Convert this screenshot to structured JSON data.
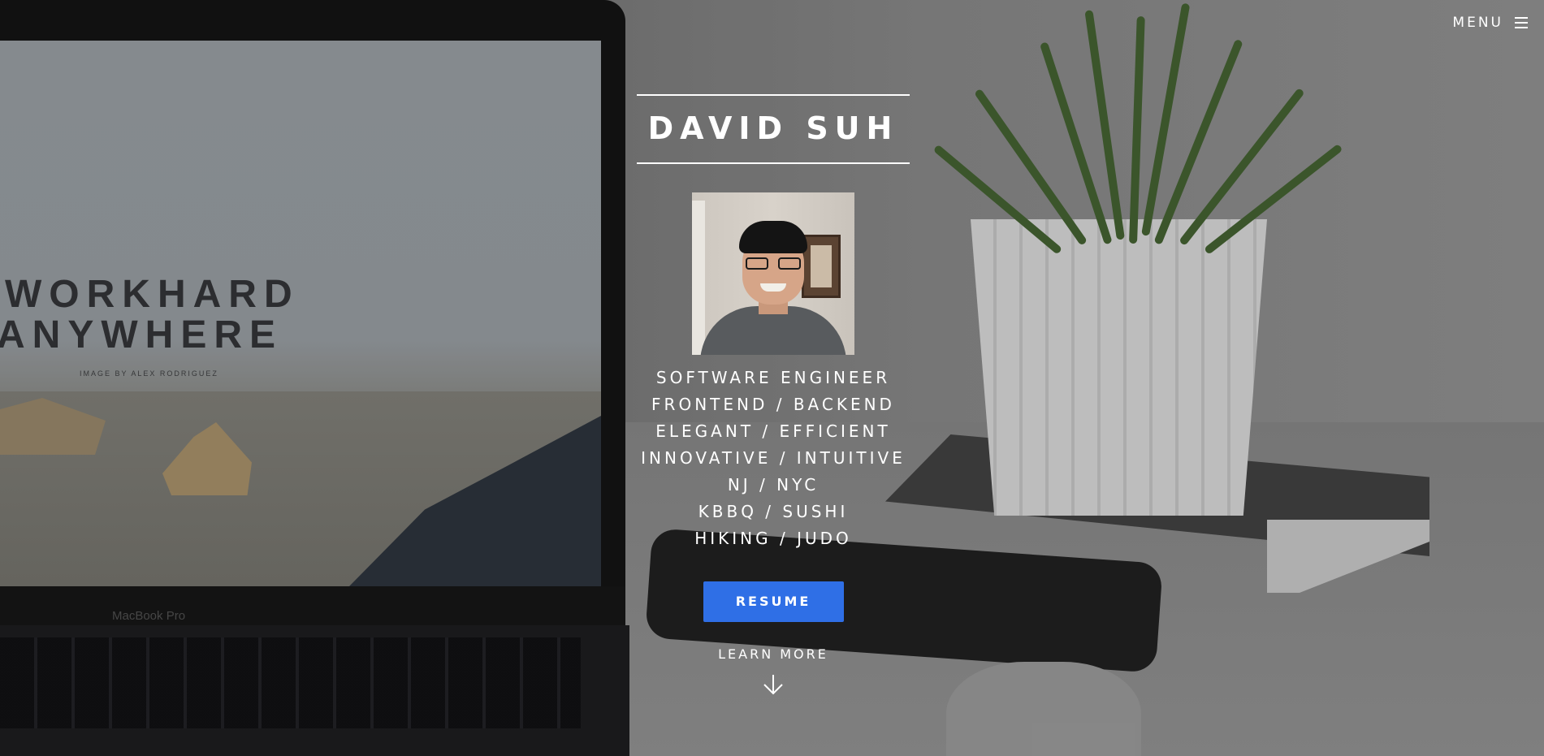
{
  "background": {
    "screen_text_line1": "WORKHARD",
    "screen_text_line2": "ANYWHERE",
    "screen_credit": "IMAGE BY ALEX RODRIGUEZ",
    "laptop_model": "MacBook Pro"
  },
  "nav": {
    "menu_label": "MENU",
    "menu_icon": "hamburger-icon"
  },
  "hero": {
    "name": "DAVID SUH",
    "taglines": [
      "SOFTWARE ENGINEER",
      "FRONTEND / BACKEND",
      "ELEGANT / EFFICIENT",
      "INNOVATIVE / INTUITIVE",
      "NJ / NYC",
      "KBBQ / SUSHI",
      "HIKING / JUDO"
    ],
    "resume_label": "RESUME",
    "learn_more_label": "LEARN MORE",
    "down_icon": "arrow-down-icon"
  },
  "colors": {
    "accent": "#2f6fe6",
    "text": "#ffffff"
  }
}
